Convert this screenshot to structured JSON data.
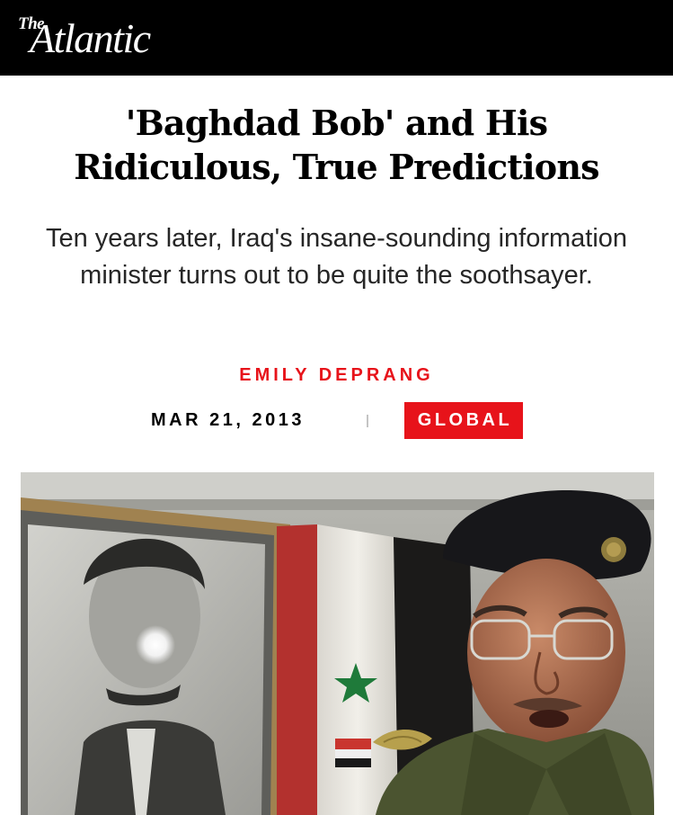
{
  "header": {
    "logo_small": "The",
    "logo_main": "Atlantic"
  },
  "article": {
    "headline": "'Baghdad Bob' and His Ridiculous, True Predictions",
    "dek": "Ten years later, Iraq's insane-sounding information minister turns out to be quite the soothsayer.",
    "author": "EMILY DEPRANG",
    "date": "MAR 21, 2013",
    "section": "GLOBAL"
  },
  "colors": {
    "brand_red": "#e7131a",
    "header_bg": "#000000"
  }
}
